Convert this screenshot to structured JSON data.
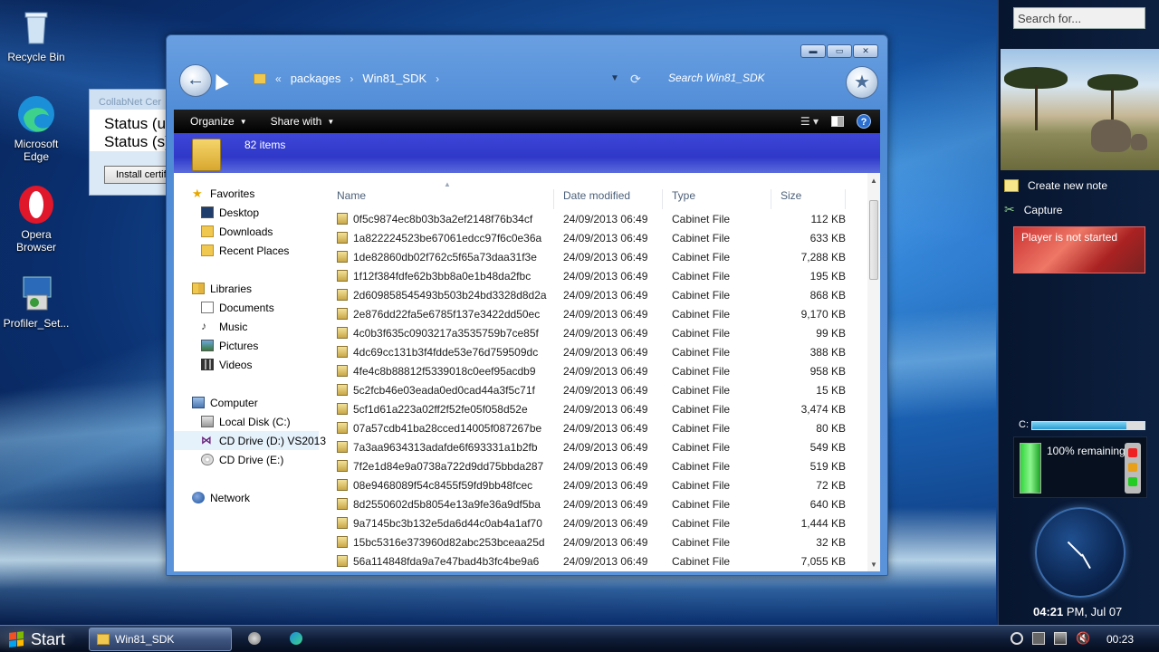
{
  "desktop": {
    "icons": [
      {
        "label": "Recycle Bin"
      },
      {
        "label": "Microsoft Edge"
      },
      {
        "label": "Opera Browser"
      },
      {
        "label": "Profiler_Set..."
      }
    ]
  },
  "collabnet": {
    "title": "CollabNet Cer",
    "status1": "Status (u:",
    "status2": "Status (s)",
    "button": "Install certifi"
  },
  "explorer": {
    "breadcrumb": [
      "packages",
      "Win81_SDK"
    ],
    "breadcrumb_prefix": "«",
    "search_placeholder": "Search Win81_SDK",
    "toolbar": {
      "organize": "Organize",
      "share": "Share with"
    },
    "item_count": "82 items",
    "nav": {
      "favorites": "Favorites",
      "favorites_items": [
        "Desktop",
        "Downloads",
        "Recent Places"
      ],
      "libraries": "Libraries",
      "libraries_items": [
        "Documents",
        "Music",
        "Pictures",
        "Videos"
      ],
      "computer": "Computer",
      "computer_items": [
        "Local Disk (C:)",
        "CD Drive (D:) VS2013",
        "CD Drive (E:)"
      ],
      "network": "Network"
    },
    "columns": {
      "name": "Name",
      "date": "Date modified",
      "type": "Type",
      "size": "Size"
    },
    "files": [
      {
        "name": "0f5c9874ec8b03b3a2ef2148f76b34cf",
        "date": "24/09/2013 06:49",
        "type": "Cabinet File",
        "size": "112 KB"
      },
      {
        "name": "1a822224523be67061edcc97f6c0e36a",
        "date": "24/09/2013 06:49",
        "type": "Cabinet File",
        "size": "633 KB"
      },
      {
        "name": "1de82860db02f762c5f65a73daa31f3e",
        "date": "24/09/2013 06:49",
        "type": "Cabinet File",
        "size": "7,288 KB"
      },
      {
        "name": "1f12f384fdfe62b3bb8a0e1b48da2fbc",
        "date": "24/09/2013 06:49",
        "type": "Cabinet File",
        "size": "195 KB"
      },
      {
        "name": "2d609858545493b503b24bd3328d8d2a",
        "date": "24/09/2013 06:49",
        "type": "Cabinet File",
        "size": "868 KB"
      },
      {
        "name": "2e876dd22fa5e6785f137e3422dd50ec",
        "date": "24/09/2013 06:49",
        "type": "Cabinet File",
        "size": "9,170 KB"
      },
      {
        "name": "4c0b3f635c0903217a3535759b7ce85f",
        "date": "24/09/2013 06:49",
        "type": "Cabinet File",
        "size": "99 KB"
      },
      {
        "name": "4dc69cc131b3f4fdde53e76d759509dc",
        "date": "24/09/2013 06:49",
        "type": "Cabinet File",
        "size": "388 KB"
      },
      {
        "name": "4fe4c8b88812f5339018c0eef95acdb9",
        "date": "24/09/2013 06:49",
        "type": "Cabinet File",
        "size": "958 KB"
      },
      {
        "name": "5c2fcb46e03eada0ed0cad44a3f5c71f",
        "date": "24/09/2013 06:49",
        "type": "Cabinet File",
        "size": "15 KB"
      },
      {
        "name": "5cf1d61a223a02ff2f52fe05f058d52e",
        "date": "24/09/2013 06:49",
        "type": "Cabinet File",
        "size": "3,474 KB"
      },
      {
        "name": "07a57cdb41ba28cced14005f087267be",
        "date": "24/09/2013 06:49",
        "type": "Cabinet File",
        "size": "80 KB"
      },
      {
        "name": "7a3aa9634313adafde6f693331a1b2fb",
        "date": "24/09/2013 06:49",
        "type": "Cabinet File",
        "size": "549 KB"
      },
      {
        "name": "7f2e1d84e9a0738a722d9dd75bbda287",
        "date": "24/09/2013 06:49",
        "type": "Cabinet File",
        "size": "519 KB"
      },
      {
        "name": "08e9468089f54c8455f59fd9bb48fcec",
        "date": "24/09/2013 06:49",
        "type": "Cabinet File",
        "size": "72 KB"
      },
      {
        "name": "8d2550602d5b8054e13a9fe36a9df5ba",
        "date": "24/09/2013 06:49",
        "type": "Cabinet File",
        "size": "640 KB"
      },
      {
        "name": "9a7145bc3b132e5da6d44c0ab4a1af70",
        "date": "24/09/2013 06:49",
        "type": "Cabinet File",
        "size": "1,444 KB"
      },
      {
        "name": "15bc5316e373960d82abc253bceaa25d",
        "date": "24/09/2013 06:49",
        "type": "Cabinet File",
        "size": "32 KB"
      },
      {
        "name": "56a114848fda9a7e47bad4b3fc4be9a6",
        "date": "24/09/2013 06:49",
        "type": "Cabinet File",
        "size": "7,055 KB"
      }
    ]
  },
  "sidebar": {
    "search_placeholder": "Search for...",
    "create_note": "Create new note",
    "capture": "Capture",
    "player": "Player is not started",
    "disk_label": "C:",
    "battery": "100% remaining",
    "time": "04:21",
    "ampm_date": "PM, Jul 07"
  },
  "taskbar": {
    "start": "Start",
    "task": "Win81_SDK",
    "clock": "00:23"
  }
}
